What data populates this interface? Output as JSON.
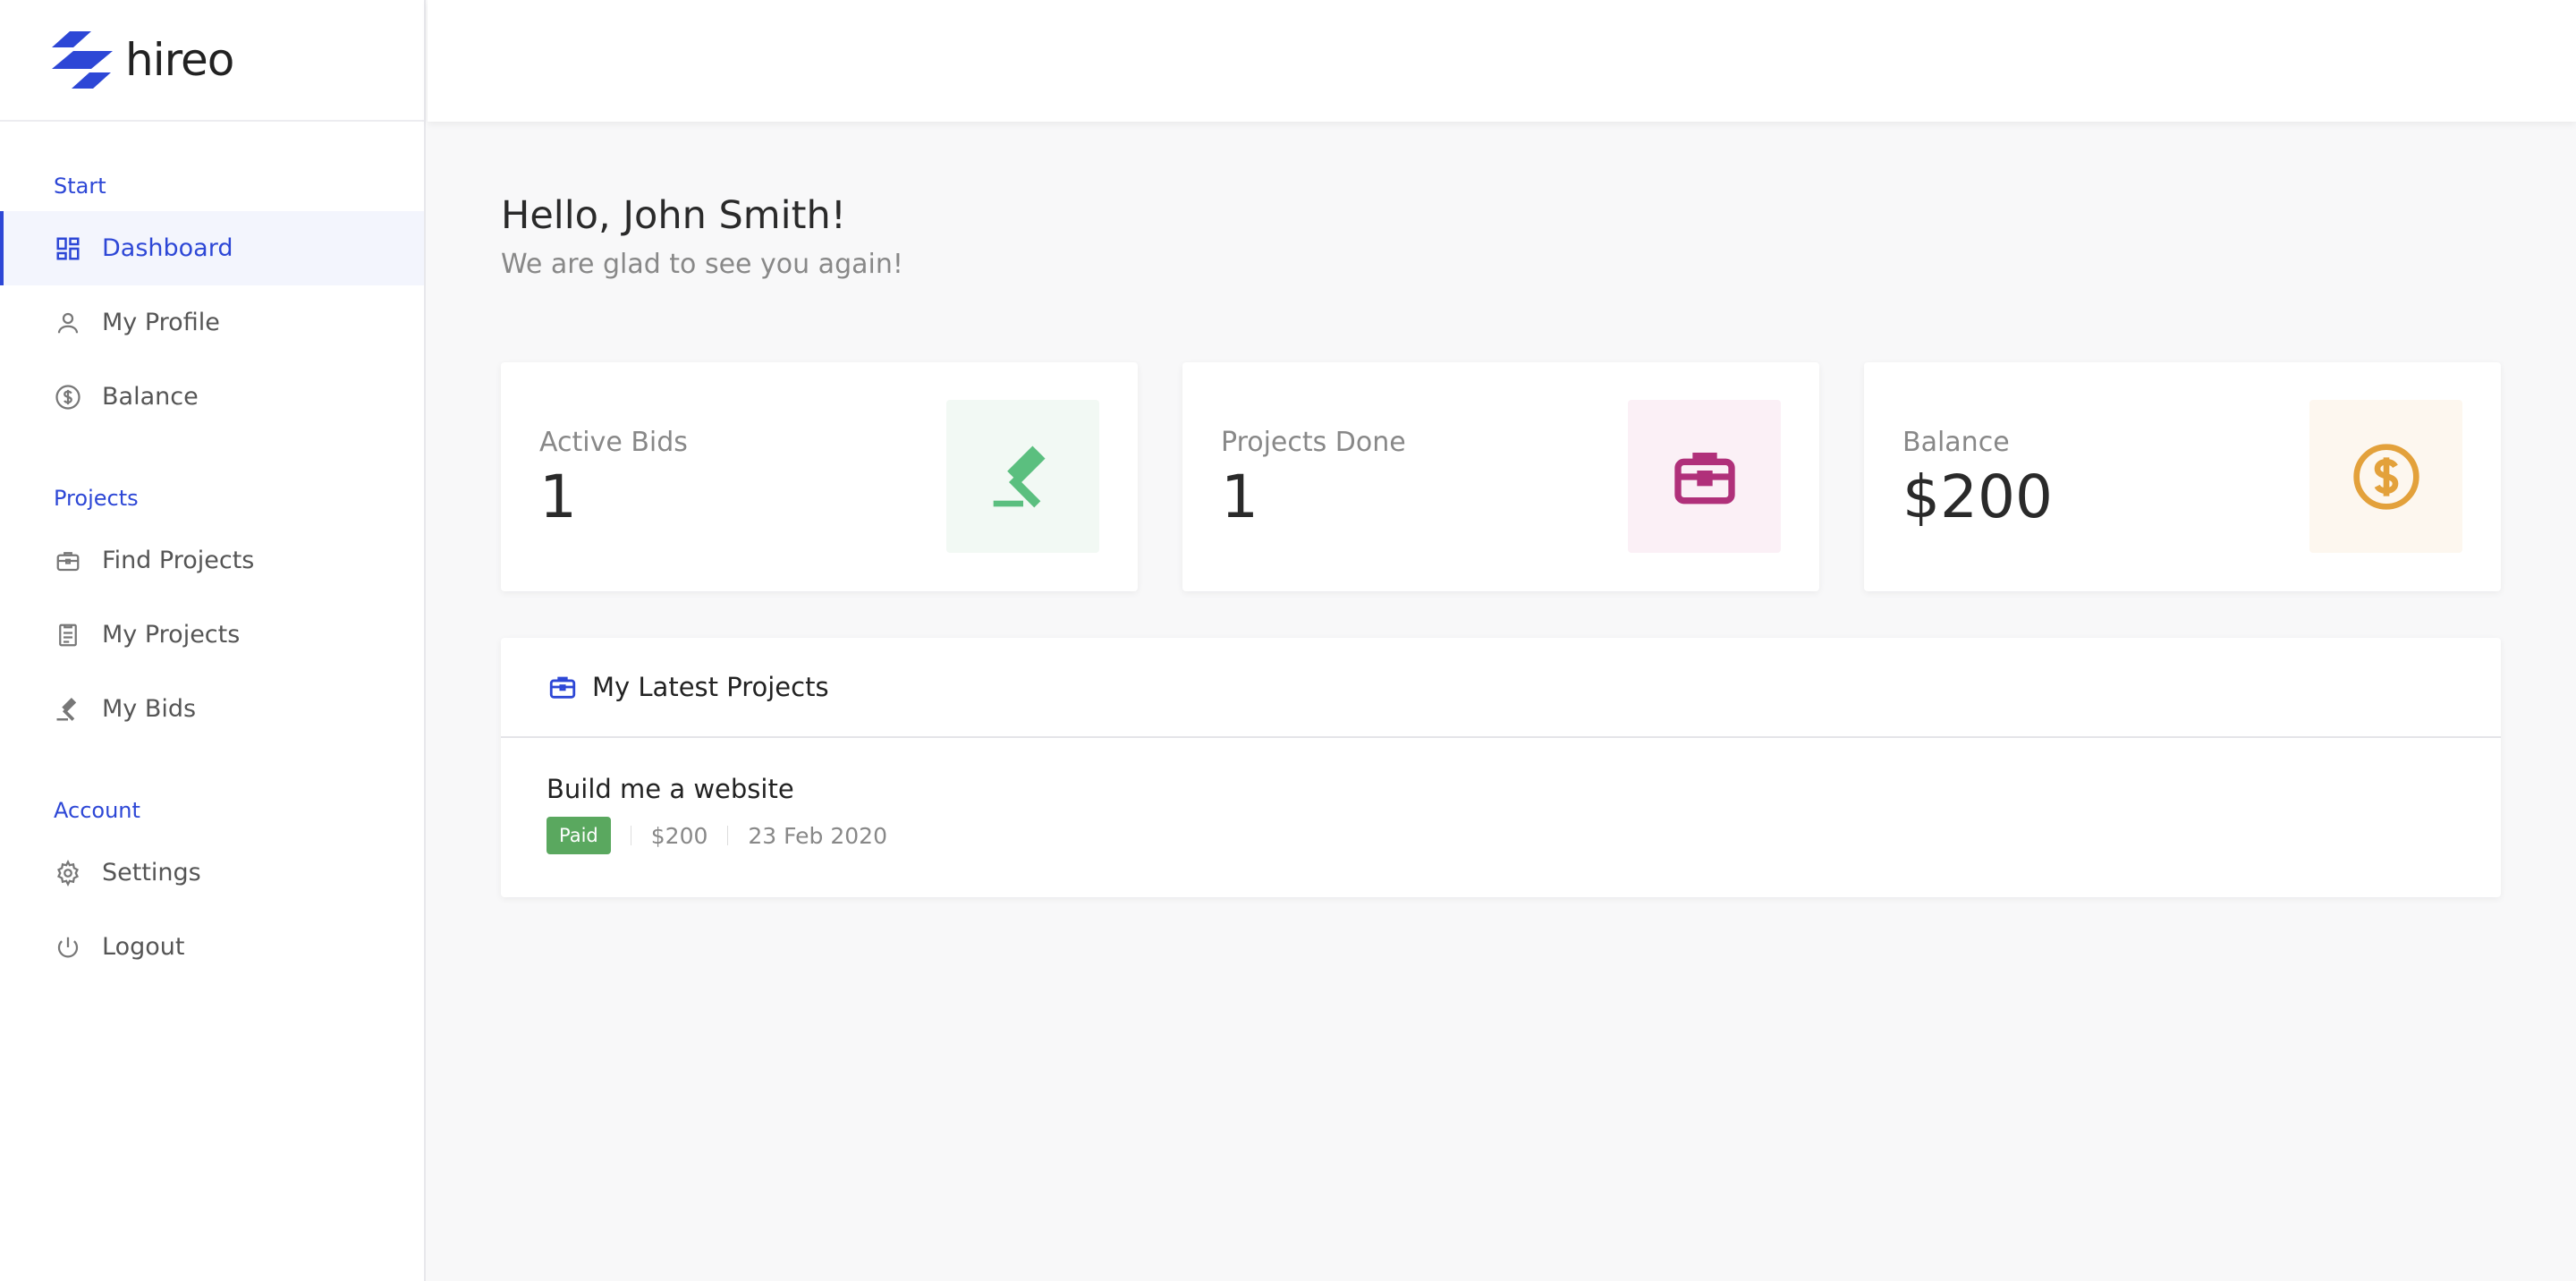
{
  "brand": {
    "name": "hireo",
    "color": "#2d47d6"
  },
  "sidebar": {
    "sections": [
      {
        "title": "Start",
        "items": [
          {
            "label": "Dashboard",
            "icon": "dashboard-icon",
            "active": true
          },
          {
            "label": "My Profile",
            "icon": "user-icon"
          },
          {
            "label": "Balance",
            "icon": "dollar-circle-icon"
          }
        ]
      },
      {
        "title": "Projects",
        "items": [
          {
            "label": "Find Projects",
            "icon": "briefcase-icon"
          },
          {
            "label": "My Projects",
            "icon": "clipboard-icon"
          },
          {
            "label": "My Bids",
            "icon": "gavel-icon"
          }
        ]
      },
      {
        "title": "Account",
        "items": [
          {
            "label": "Settings",
            "icon": "gear-icon"
          },
          {
            "label": "Logout",
            "icon": "power-icon"
          }
        ]
      }
    ]
  },
  "main": {
    "greeting": "Hello, John Smith!",
    "subtitle": "We are glad to see you again!",
    "stats": [
      {
        "label": "Active Bids",
        "value": "1",
        "icon": "gavel-icon",
        "bg": "#f2f9f4",
        "color": "#5bbf7f"
      },
      {
        "label": "Projects Done",
        "value": "1",
        "icon": "briefcase-icon",
        "bg": "#fbf0f6",
        "color": "#b0307a"
      },
      {
        "label": "Balance",
        "value": "$200",
        "icon": "dollar-circle-icon",
        "bg": "#fdf7ef",
        "color": "#e3a13b"
      }
    ],
    "latest": {
      "title": "My Latest Projects",
      "projects": [
        {
          "title": "Build me a website",
          "status": "Paid",
          "amount": "$200",
          "date": "23 Feb 2020"
        }
      ]
    }
  }
}
